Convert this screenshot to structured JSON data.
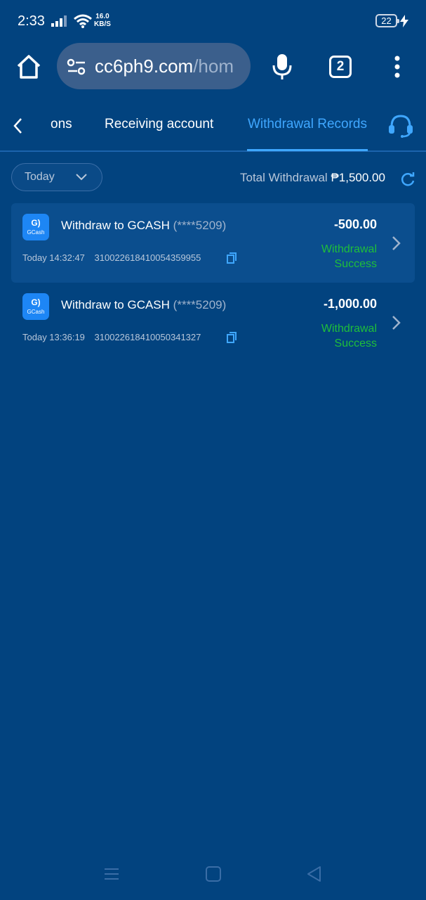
{
  "status_bar": {
    "time": "2:33",
    "speed_value": "16.0",
    "speed_unit": "KB/S",
    "battery": "22"
  },
  "browser": {
    "url_main": "cc6ph9.com",
    "url_rest": "/hom",
    "tab_count": "2"
  },
  "tabs": [
    {
      "label": "ons",
      "active": false
    },
    {
      "label": "Receiving account",
      "active": false
    },
    {
      "label": "Withdrawal Records",
      "active": true
    }
  ],
  "filter": {
    "selected": "Today"
  },
  "summary": {
    "label": "Total Withdrawal",
    "amount": "₱1,500.00"
  },
  "records": [
    {
      "title": "Withdraw to GCASH",
      "account": "(****5209)",
      "time": "Today 14:32:47",
      "order_id": "310022618410054359955",
      "amount": "-500.00",
      "status_line1": "Withdrawal",
      "status_line2": "Success",
      "logo_text": "GCash"
    },
    {
      "title": "Withdraw to GCASH",
      "account": "(****5209)",
      "time": "Today 13:36:19",
      "order_id": "310022618410050341327",
      "amount": "-1,000.00",
      "status_line1": "Withdrawal",
      "status_line2": "Success",
      "logo_text": "GCash"
    }
  ],
  "colors": {
    "background": "#02437f",
    "accent": "#3fa7ff",
    "success": "#1fbf3a"
  }
}
